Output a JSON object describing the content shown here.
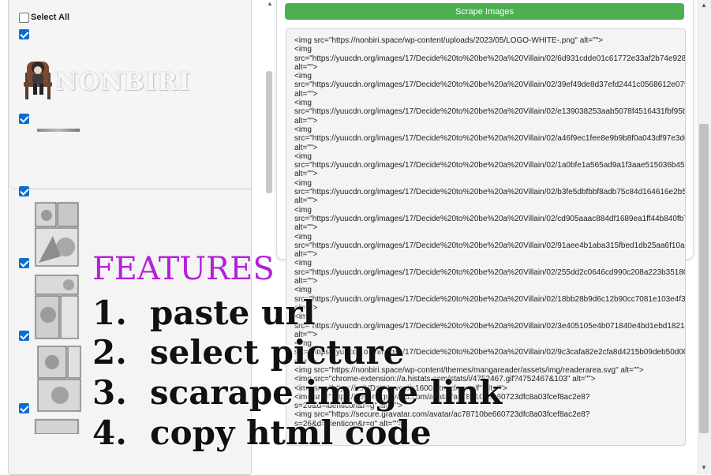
{
  "left_panel": {
    "select_all_label": "Select All",
    "logo_text": "NONBIRI",
    "items": [
      {
        "name": "logo-image",
        "checked": true
      },
      {
        "name": "thin-image",
        "checked": true
      },
      {
        "name": "page-image-1",
        "checked": true
      },
      {
        "name": "page-image-2",
        "checked": true
      },
      {
        "name": "page-image-3",
        "checked": true
      },
      {
        "name": "page-image-4",
        "checked": true
      }
    ]
  },
  "toolbar": {
    "scrape_button_label": "Scrape Images",
    "scrape_button_color": "#4caf50"
  },
  "code_output": {
    "lines": [
      "<img src=\"https://nonbiri.space/wp-content/uploads/2023/05/LOGO-WHITE-.png\" alt=\"\">",
      "<img",
      "src=\"https://yuucdn.org/images/17/Decide%20to%20be%20a%20Villain/02/6d931cdde01c61772e33af2b74e928dc",
      "alt=\"\">",
      "<img",
      "src=\"https://yuucdn.org/images/17/Decide%20to%20be%20a%20Villain/02/39ef49de8d37efd2441c0568612e0790",
      "alt=\"\">",
      "<img",
      "src=\"https://yuucdn.org/images/17/Decide%20to%20be%20a%20Villain/02/e139038253aab5078f4516431fbf95b9",
      "alt=\"\">",
      "<img",
      "src=\"https://yuucdn.org/images/17/Decide%20to%20be%20a%20Villain/02/a46f9ec1fee8e9b9b8f0a043df97e3d6a",
      "alt=\"\">",
      "<img",
      "src=\"https://yuucdn.org/images/17/Decide%20to%20be%20a%20Villain/02/1a0bfe1a565ad9a1f3aae515036b4502",
      "alt=\"\">",
      "<img",
      "src=\"https://yuucdn.org/images/17/Decide%20to%20be%20a%20Villain/02/b3fe5dbfbbf8adb75c84d164616e2b5f1",
      "alt=\"\">",
      "<img",
      "src=\"https://yuucdn.org/images/17/Decide%20to%20be%20a%20Villain/02/cd905aaac884df1689ea1ff44b840fb7c",
      "alt=\"\">",
      "<img",
      "src=\"https://yuucdn.org/images/17/Decide%20to%20be%20a%20Villain/02/91aee4b1aba315fbed1db25aa6f10a55",
      "alt=\"\">",
      "<img",
      "src=\"https://yuucdn.org/images/17/Decide%20to%20be%20a%20Villain/02/255dd2c0646cd990c208a223b3518053",
      "alt=\"\">",
      "<img",
      "src=\"https://yuucdn.org/images/17/Decide%20to%20be%20a%20Villain/02/18bb28b9d6c12b90cc7081e103e4f37f",
      "alt=\"\">",
      "<img",
      "src=\"https://yuucdn.org/images/17/Decide%20to%20be%20a%20Villain/02/3e405105e4b071840e4bd1ebd1821af5",
      "alt=\"\">",
      "<img",
      "src=\"https://yuucdn.org/images/17/Decide%20to%20be%20a%20Villain/02/9c3cafa82e2cfa8d4215b09deb50d008",
      "alt=\"\">",
      "<img src=\"https://nonbiri.space/wp-content/themes/mangareader/assets/img/readerarea.svg\" alt=\"\">",
      "<img src=\"chrome-extension://a.histats.com/stats/i/4752467.gif?4752467&103\" alt=\"\">",
      "<img src=\"https://.../UDzU4rrvcal/s1600/btn_close.gif\" alt=\"\">",
      "<img src=\"https://secure.gravatar.com/avatar/ac78710be660723dfc8a03fcef8ac2e8?",
      "s=26&d=identicon&r=g\" alt=\"\">",
      "<img src=\"https://secure.gravatar.com/avatar/ac78710be660723dfc8a03fcef8ac2e8?",
      "s=26&d=identicon&r=g\" alt=\"\">"
    ]
  },
  "features": {
    "title": "FEATURES",
    "title_color": "#b51fd9",
    "items": [
      {
        "number": "1.",
        "text": "paste url"
      },
      {
        "number": "2.",
        "text": "select picture"
      },
      {
        "number": "3.",
        "text": "scarape image link"
      },
      {
        "number": "4.",
        "text": "copy html code"
      }
    ]
  }
}
